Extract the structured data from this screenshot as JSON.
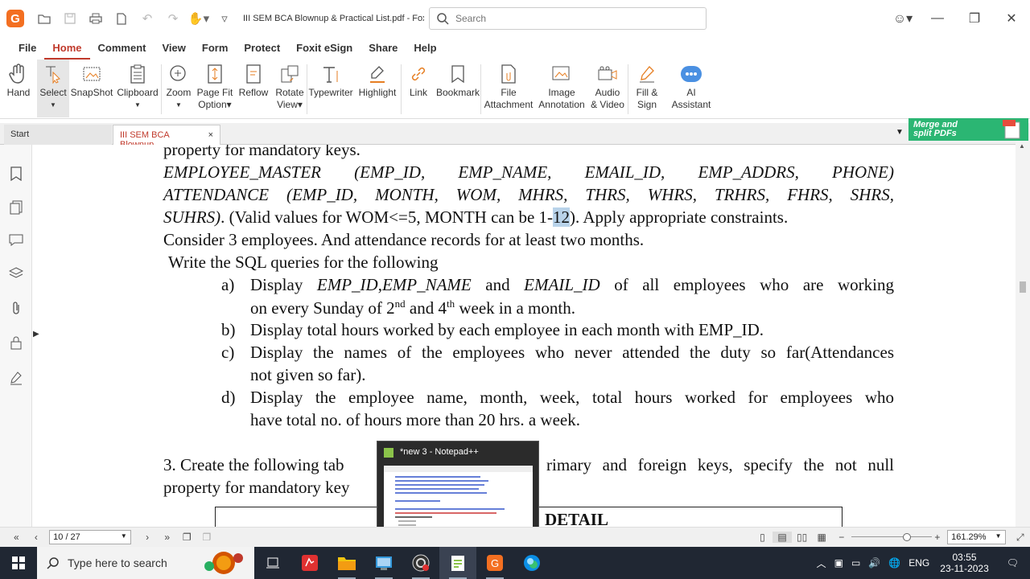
{
  "titlebar": {
    "logo": "G",
    "doc_title": "III SEM BCA Blownup & Practical List.pdf - Fox...",
    "search_placeholder": "Search"
  },
  "menu": [
    "File",
    "Home",
    "Comment",
    "View",
    "Form",
    "Protect",
    "Foxit eSign",
    "Share",
    "Help"
  ],
  "ribbon": {
    "hand": "Hand",
    "select": "Select",
    "snapshot": "SnapShot",
    "clipboard": "Clipboard",
    "zoom": "Zoom",
    "pagefit": "Page Fit",
    "pagefit2": "Option",
    "reflow": "Reflow",
    "rotate": "Rotate",
    "rotate2": "View",
    "typewriter": "Typewriter",
    "highlight": "Highlight",
    "link": "Link",
    "bookmark": "Bookmark",
    "fileatt": "File",
    "fileatt2": "Attachment",
    "imgann": "Image",
    "imgann2": "Annotation",
    "audio": "Audio",
    "audio2": "& Video",
    "fill": "Fill &",
    "fill2": "Sign",
    "ai": "AI",
    "ai2": "Assistant"
  },
  "tabs": {
    "start": "Start",
    "doc": "III SEM BCA Blownup...",
    "close": "×"
  },
  "banner": {
    "line1": "Merge and",
    "line2": "split PDFs"
  },
  "doc": {
    "l1": "property for mandatory keys.",
    "l2": "EMPLOYEE_MASTER (EMP_ID, EMP_NAME, EMAIL_ID, EMP_ADDRS, PHONE)",
    "l3": "ATTENDANCE (EMP_ID, MONTH, WOM, MHRS, THRS, WHRS, TRHRS, FHRS, SHRS,",
    "l4a": "SUHRS)",
    "l4b": ". (Valid values for WOM<=5, MONTH can be 1-",
    "l4sel": "12",
    "l4c": "). Apply appropriate constraints.",
    "l5": "Consider 3 employees. And attendance records for at least two months.",
    "l6": "Write the SQL queries for the following",
    "a_mark": "a)",
    "a1_pre": "Display ",
    "a1_i1": "EMP_ID",
    "a1_c": ",",
    "a1_i2": "EMP_NAME",
    "a1_and": " and ",
    "a1_i3": "EMAIL_ID",
    "a1_post": " of all employees who are working",
    "a2_a": "on every Sunday of 2",
    "a2_sup1": "nd",
    "a2_b": " and 4",
    "a2_sup2": "th",
    "a2_c": " week in a month.",
    "b_mark": "b)",
    "b1": "Display total hours worked by each employee in each month with EMP_ID.",
    "c_mark": "c)",
    "c1": "Display the names of the employees who never attended the duty so far(Attendances",
    "c2": "not given so far).",
    "d_mark": "d)",
    "d1": "Display the employee name, month, week, total hours worked for employees who",
    "d2": "have total no. of hours more than 20 hrs. a week.",
    "q3a": "3. Create the following tab",
    "q3b": "rimary and foreign keys, specify the not null",
    "q3c": "property for mandatory key",
    "table_head": "DETAIL"
  },
  "thumbnail": {
    "title": "*new 3 - Notepad++"
  },
  "status": {
    "page": "10 / 27",
    "zoom": "161.29%"
  },
  "taskbar": {
    "search_placeholder": "Type here to search",
    "lang": "ENG",
    "time": "03:55",
    "date": "23-11-2023"
  }
}
